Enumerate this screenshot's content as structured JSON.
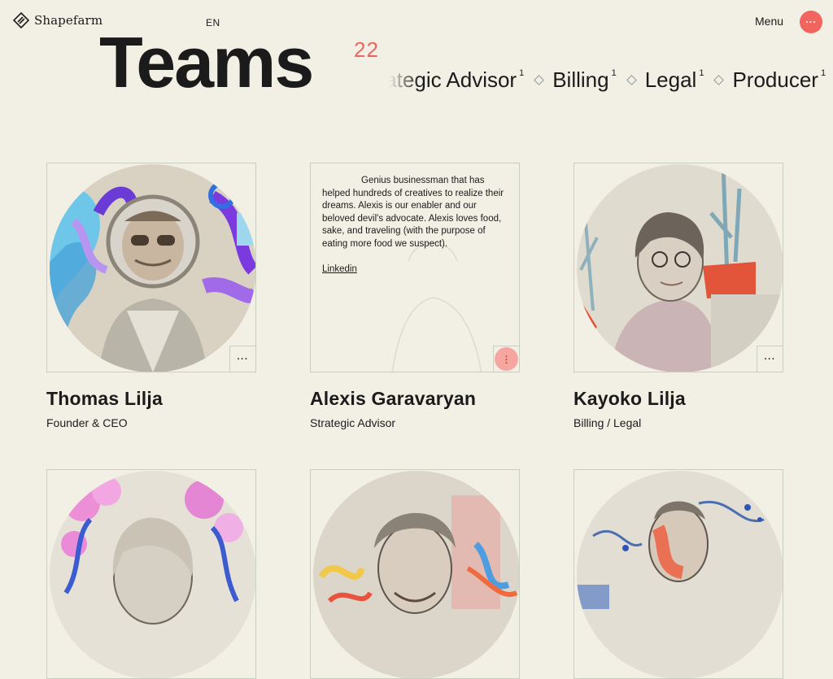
{
  "brand": {
    "name": "Shapefarm"
  },
  "header": {
    "lang": "EN",
    "menu_label": "Menu",
    "menu_icon": "···"
  },
  "hero": {
    "title": "Teams",
    "count": "22",
    "ticker": [
      {
        "label": "Strategic Advisor",
        "sup": "1"
      },
      {
        "label": "Billing",
        "sup": "1"
      },
      {
        "label": "Legal",
        "sup": "1"
      },
      {
        "label": "Producer",
        "sup": "1"
      }
    ]
  },
  "members": [
    {
      "name": "Thomas Lilja",
      "role": "Founder & CEO",
      "more": "···"
    },
    {
      "name": "Alexis Garavaryan",
      "role": "Strategic Advisor",
      "bio": "Genius businessman that has helped hundreds of creatives to realize their dreams. Alexis is our enabler and our beloved devil's advocate. Alexis loves food, sake, and traveling (with the purpose of eating more food we suspect).",
      "link": "Linkedin",
      "more": "⋮"
    },
    {
      "name": "Kayoko Lilja",
      "role": "Billing / Legal",
      "more": "···"
    }
  ],
  "colors": {
    "background": "#f2efe4",
    "accent": "#f2655f",
    "frame": "#c9cfbf"
  }
}
